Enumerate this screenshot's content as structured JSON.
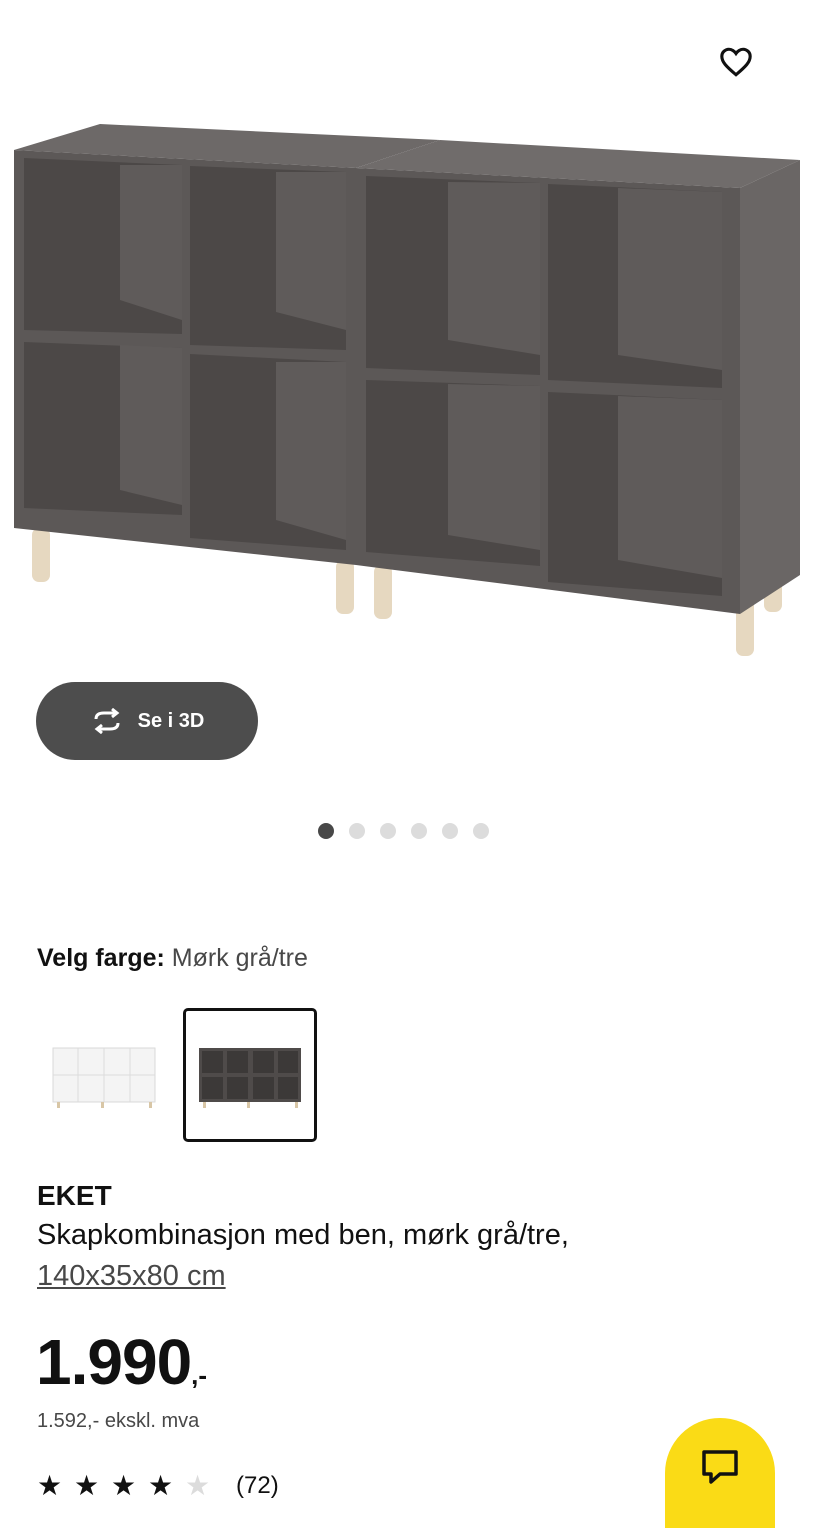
{
  "hero": {
    "image_alt": "",
    "favorite_icon": "heart-outline-icon",
    "view_3d": {
      "label": "Se i 3D",
      "icon": "rotate-3d-icon"
    },
    "carousel_count": 6,
    "carousel_active": 1
  },
  "color": {
    "label": "Velg farge:",
    "selected": "Mørk grå/tre",
    "swatches": [
      "white",
      "dark-grey"
    ],
    "selected_index": 1
  },
  "product": {
    "name": "EKET",
    "description": "Skapkombinasjon med ben, mørk grå/tre,",
    "size": "140x35x80 cm",
    "price_main": "1.990",
    "price_suffix": ",-",
    "price_ex_vat": "1.592,- ekskl. mva",
    "rating": 4,
    "rating_max": 5,
    "review_count": "(72)"
  },
  "chat": {
    "icon": "chat-icon"
  },
  "colors": {
    "accent_yellow": "#fadb16",
    "cabinet_dark": "#5a5654",
    "button_dark": "#4d4d4d"
  }
}
